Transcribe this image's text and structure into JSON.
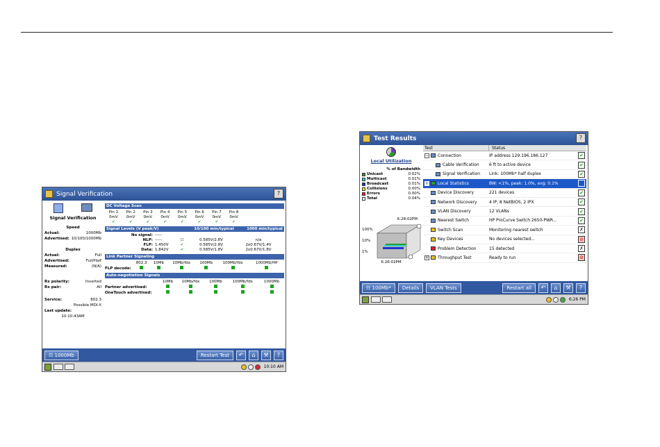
{
  "signal_verification": {
    "title": "Signal Verification",
    "panel_title": "Signal Verification",
    "speed": {
      "heading": "Speed",
      "actual_label": "Actual:",
      "actual_value": "1000Mb",
      "advertised_label": "Advertised:",
      "advertised_value": "10/100/1000Mb"
    },
    "duplex": {
      "heading": "Duplex",
      "actual_label": "Actual:",
      "actual_value": "Full",
      "advertised_label": "Advertised:",
      "advertised_value": "Full/Half",
      "measured_label": "Measured:",
      "measured_value": "(N/A)"
    },
    "rx_polarity_label": "Rx polarity:",
    "rx_polarity_value": "Inverted",
    "rx_pair_label": "Rx pair:",
    "rx_pair_value": "All",
    "service_label": "Service:",
    "service_value": "802.3",
    "service_note": "Possible MDI-X",
    "last_update_label": "Last update:",
    "last_update_value": "10:10:43AM",
    "dc_voltage": {
      "heading": "DC Voltage Scan",
      "pins": [
        "Pin 1",
        "Pin 2",
        "Pin 3",
        "Pin 4",
        "Pin 5",
        "Pin 6",
        "Pin 7",
        "Pin 8"
      ],
      "volts": [
        "0mV",
        "0mV",
        "0mV",
        "0mV",
        "0mV",
        "0mV",
        "0mV",
        "0mV"
      ]
    },
    "signal_levels": {
      "heading": "Signal Levels (V peak/V)",
      "col2": "10/100 min/typical",
      "col3": "1000 min/typical",
      "rows": [
        {
          "label": "No signal:",
          "v1": "-----",
          "v2": "",
          "v3": "",
          "v4": ""
        },
        {
          "label": "NLP:",
          "v1": "-----",
          "v2": "",
          "v3": "0.585V/2.8V",
          "v4": "n/a"
        },
        {
          "label": "FLP:",
          "v1": "1.450V",
          "v2": "",
          "v3": "0.585V/2.8V",
          "v4": "2x0.67V/1.4V"
        },
        {
          "label": "Data:",
          "v1": "1.842V",
          "v2": "",
          "v3": "0.585V/1.8V",
          "v4": "2x0.67V/1.8V"
        }
      ]
    },
    "link_partner": {
      "heading": "Link Partner Signaling",
      "cols": [
        "802.3",
        "10Mb",
        "10Mb/fdx",
        "100Mb",
        "100Mb/fdx",
        "1000Mb/HP"
      ],
      "row_label": "FLP decode:"
    },
    "autoneg": {
      "heading": "Auto-negotiation Signals",
      "cols": [
        "10Mb",
        "10Mb/fdx",
        "100Mb",
        "100Mb/fdx",
        "1000Mb"
      ],
      "rows": [
        "Partner advertised:",
        "OneTouch advertised:"
      ]
    },
    "buttons": {
      "speed": "1000Mb",
      "restart": "Restart Test"
    },
    "status_time": "10:10 AM"
  },
  "test_results": {
    "title": "Test Results",
    "panel_title": "Local Utilization",
    "bandwidth_label": "% of Bandwidth",
    "legend": [
      {
        "name": "Unicast",
        "value": "0.02%",
        "color": "#2a9d2a"
      },
      {
        "name": "Multicast",
        "value": "0.01%",
        "color": "#33cccc"
      },
      {
        "name": "Broadcast",
        "value": "0.01%",
        "color": "#2233cc"
      },
      {
        "name": "Collisions",
        "value": "0.00%",
        "color": "#f0e030"
      },
      {
        "name": "Errors",
        "value": "0.00%",
        "color": "#dd2222"
      },
      {
        "name": "Total",
        "value": "0.04%",
        "color": "#ffffff"
      }
    ],
    "time_top": "6:28:02PM",
    "time_bottom": "6:26:02PM",
    "y_labels": [
      "100%",
      "10%",
      "1%"
    ],
    "col_test": "Test",
    "col_status": "Status",
    "rows": [
      {
        "test": "Connection",
        "status": "IP address 129.196.186.127",
        "mark": "pass"
      },
      {
        "test": "Cable Verification",
        "status": "6 ft to active device",
        "mark": "pass"
      },
      {
        "test": "Signal Verification",
        "status": "Link: 100Mb* half duplex",
        "mark": "pass"
      },
      {
        "test": "Local Statistics",
        "status": "BW: <1%, peak: 1.0%, avg: 0.1%",
        "mark": "blank"
      },
      {
        "test": "Device Discovery",
        "status": "221 devices",
        "mark": "pass"
      },
      {
        "test": "Network Discovery",
        "status": "4 IP, 8 NetBIOS, 2 IPX",
        "mark": "pass"
      },
      {
        "test": "VLAN Discovery",
        "status": "12 VLANs",
        "mark": "pass"
      },
      {
        "test": "Nearest Switch",
        "status": "HP ProCurve Switch 2650-PWR...",
        "mark": "pass"
      },
      {
        "test": "Switch Scan",
        "status": "Monitoring nearest switch",
        "mark": "warn"
      },
      {
        "test": "Key Devices",
        "status": "No devices selected...",
        "mark": "fail"
      },
      {
        "test": "Problem Detection",
        "status": "15 detected",
        "mark": "warn"
      },
      {
        "test": "Throughput Test",
        "status": "Ready to run",
        "mark": "fail"
      }
    ],
    "buttons": {
      "speed": "100Mb*",
      "details": "Details",
      "vlan": "VLAN Tests",
      "restart": "Restart all"
    },
    "status_time": "6:26 PM"
  }
}
